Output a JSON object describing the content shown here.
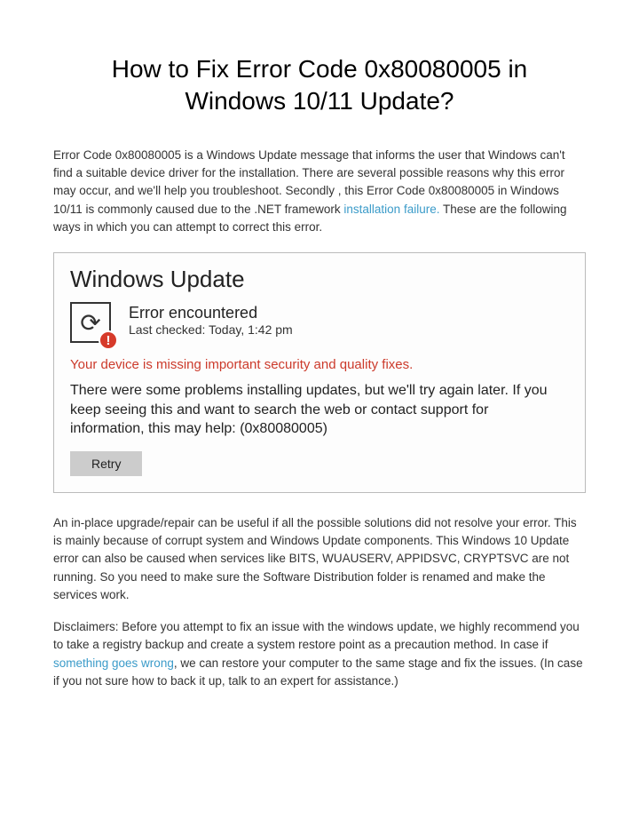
{
  "title": "How to Fix Error Code 0x80080005 in Windows 10/11 Update?",
  "intro": {
    "part1": "Error Code 0x80080005 is a Windows Update message that informs the user that Windows can't find a suitable device driver for the installation. There are several possible reasons why this error may occur, and we'll help you troubleshoot. Secondly , this Error Code 0x80080005 in Windows 10/11 is commonly caused due to the .NET framework ",
    "link1": "installation failure.",
    "part2": " These are the following ways in which you can attempt to correct this error."
  },
  "updateBox": {
    "heading": "Windows Update",
    "errorLabel": "Error encountered",
    "lastChecked": "Last checked: Today, 1:42 pm",
    "warning": "Your device is missing important security and quality fixes.",
    "body": "There were some problems installing updates, but we'll try again later. If you keep seeing this and want to search the web or contact support for information, this may help: (0x80080005)",
    "retry": "Retry"
  },
  "para2": "An in-place upgrade/repair can be useful if all the possible solutions did not resolve your error. This is mainly because of corrupt system and Windows Update components. This Windows 10 Update error can also be caused when services like BITS, WUAUSERV, APPIDSVC, CRYPTSVC are not running. So you need to make sure the Software Distribution folder is renamed and make the services work.",
  "disclaimer": {
    "part1": "Disclaimers: Before you attempt to fix an issue with the windows update, we highly recommend you to take a registry backup and create a system restore point as a precaution method. In case if ",
    "link": "something goes wrong",
    "part2": ", we can restore your computer to the same stage and fix the issues. (In case if you not sure how to back it up, talk to an expert for assistance.)"
  }
}
